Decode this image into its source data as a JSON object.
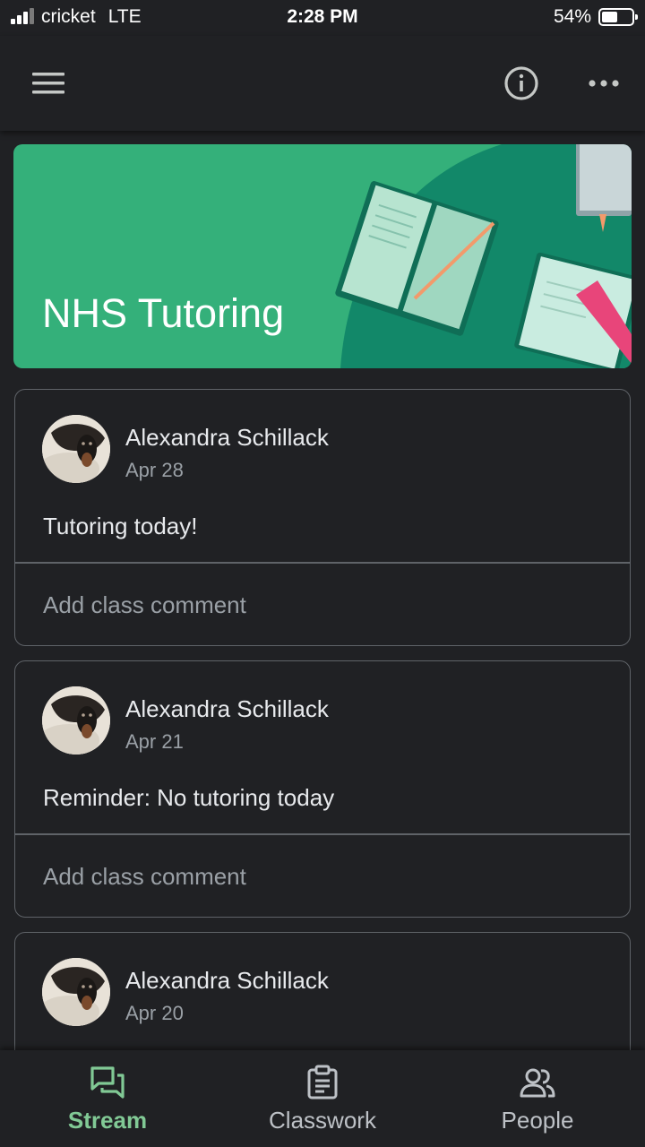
{
  "status_bar": {
    "carrier": "cricket",
    "network": "LTE",
    "time": "2:28 PM",
    "battery": "54%",
    "battery_level": 0.54
  },
  "header": {
    "icons": [
      "menu-icon",
      "info-icon",
      "more-icon"
    ]
  },
  "banner": {
    "title": "NHS Tutoring",
    "color": "#34b07a"
  },
  "posts": [
    {
      "author": "Alexandra Schillack",
      "date": "Apr 28",
      "text": "Tutoring today!",
      "comment_placeholder": "Add class comment"
    },
    {
      "author": "Alexandra Schillack",
      "date": "Apr 21",
      "text": "Reminder: No tutoring today",
      "comment_placeholder": "Add class comment"
    },
    {
      "author": "Alexandra Schillack",
      "date": "Apr 20"
    }
  ],
  "bottom_nav": {
    "items": [
      {
        "label": "Stream",
        "icon": "stream-icon",
        "active": true
      },
      {
        "label": "Classwork",
        "icon": "classwork-icon",
        "active": false
      },
      {
        "label": "People",
        "icon": "people-icon",
        "active": false
      }
    ]
  },
  "colors": {
    "background": "#202124",
    "accent": "#81c995",
    "banner": "#34b07a"
  }
}
